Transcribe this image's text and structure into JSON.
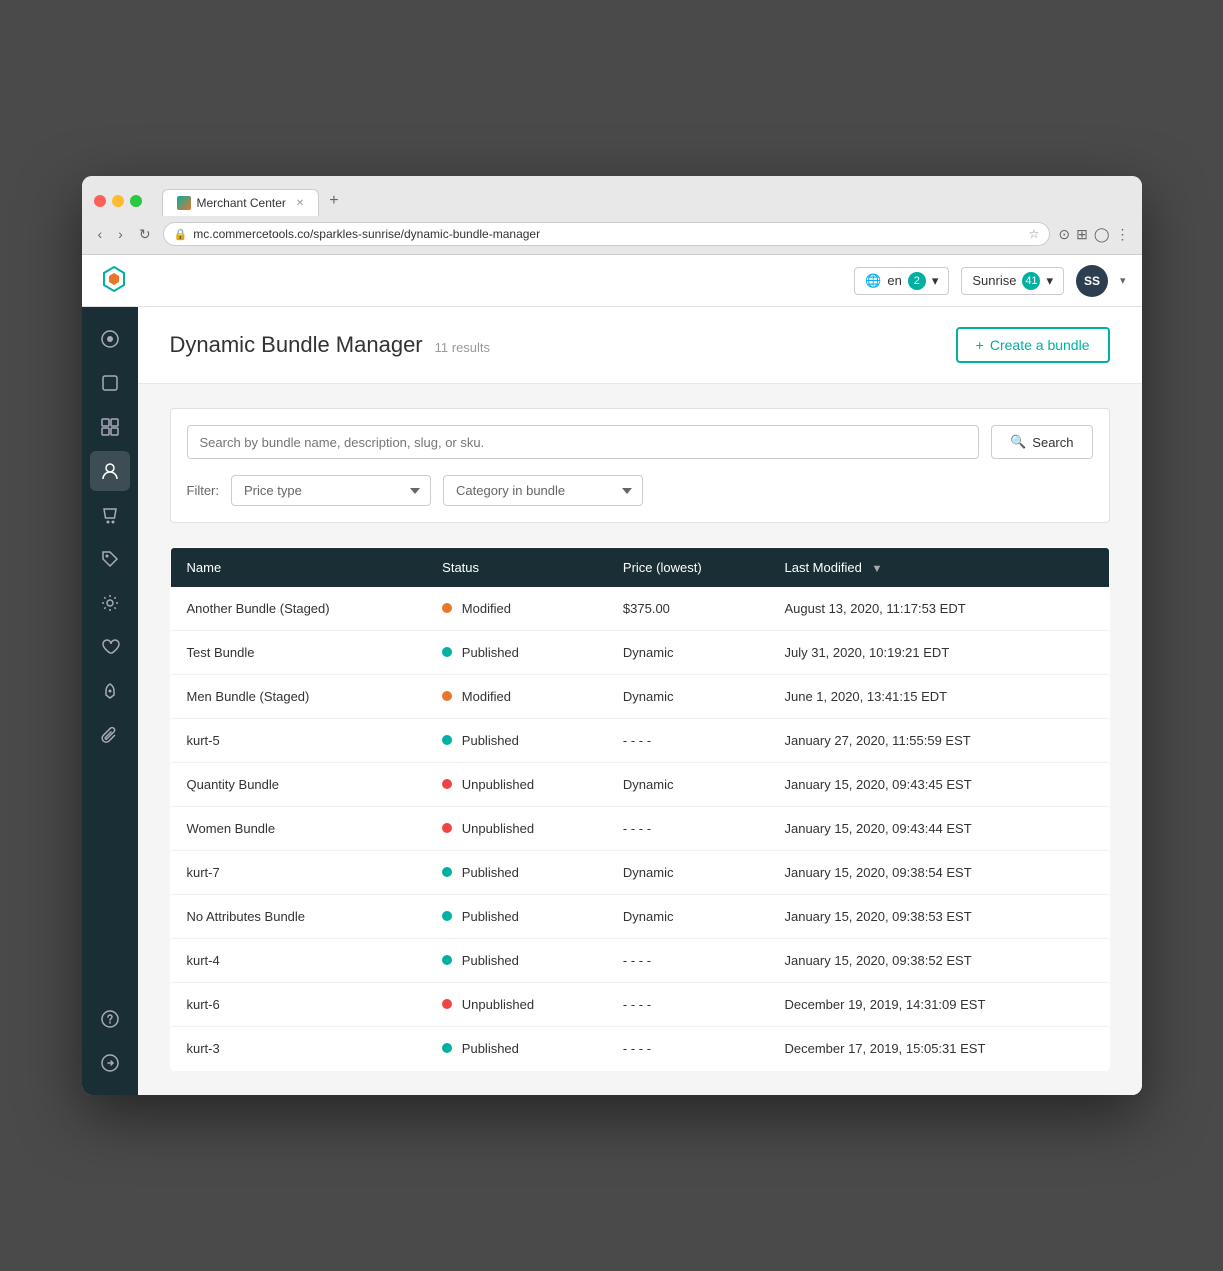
{
  "browser": {
    "url": "mc.commercetools.co/sparkles-sunrise/dynamic-bundle-manager",
    "tab_title": "Merchant Center"
  },
  "topbar": {
    "locale_label": "en",
    "locale_count": "2",
    "project_name": "Sunrise",
    "project_count": "41",
    "avatar_initials": "SS"
  },
  "page": {
    "title": "Dynamic Bundle Manager",
    "results_count": "11 results",
    "create_button": "Create a bundle",
    "search_placeholder": "Search by bundle name, description, slug, or sku.",
    "search_button": "Search",
    "filter_label": "Filter:",
    "filter_price_type": "Price type",
    "filter_category": "Category in bundle"
  },
  "table": {
    "columns": [
      "Name",
      "Status",
      "Price (lowest)",
      "Last Modified"
    ],
    "rows": [
      {
        "name": "Another Bundle (Staged)",
        "status": "Modified",
        "status_type": "modified",
        "price": "$375.00",
        "last_modified": "August 13, 2020, 11:17:53 EDT"
      },
      {
        "name": "Test Bundle",
        "status": "Published",
        "status_type": "published",
        "price": "Dynamic",
        "last_modified": "July 31, 2020, 10:19:21 EDT"
      },
      {
        "name": "Men Bundle (Staged)",
        "status": "Modified",
        "status_type": "modified",
        "price": "Dynamic",
        "last_modified": "June 1, 2020, 13:41:15 EDT"
      },
      {
        "name": "kurt-5",
        "status": "Published",
        "status_type": "published",
        "price": "- - - -",
        "last_modified": "January 27, 2020, 11:55:59 EST"
      },
      {
        "name": "Quantity Bundle",
        "status": "Unpublished",
        "status_type": "unpublished",
        "price": "Dynamic",
        "last_modified": "January 15, 2020, 09:43:45 EST"
      },
      {
        "name": "Women Bundle",
        "status": "Unpublished",
        "status_type": "unpublished",
        "price": "- - - -",
        "last_modified": "January 15, 2020, 09:43:44 EST"
      },
      {
        "name": "kurt-7",
        "status": "Published",
        "status_type": "published",
        "price": "Dynamic",
        "last_modified": "January 15, 2020, 09:38:54 EST"
      },
      {
        "name": "No Attributes Bundle",
        "status": "Published",
        "status_type": "published",
        "price": "Dynamic",
        "last_modified": "January 15, 2020, 09:38:53 EST"
      },
      {
        "name": "kurt-4",
        "status": "Published",
        "status_type": "published",
        "price": "- - - -",
        "last_modified": "January 15, 2020, 09:38:52 EST"
      },
      {
        "name": "kurt-6",
        "status": "Unpublished",
        "status_type": "unpublished",
        "price": "- - - -",
        "last_modified": "December 19, 2019, 14:31:09 EST"
      },
      {
        "name": "kurt-3",
        "status": "Published",
        "status_type": "published",
        "price": "- - - -",
        "last_modified": "December 17, 2019, 15:05:31 EST"
      }
    ]
  },
  "sidebar": {
    "items": [
      {
        "id": "dashboard",
        "icon": "⊙",
        "label": "Dashboard"
      },
      {
        "id": "products",
        "icon": "◻",
        "label": "Products"
      },
      {
        "id": "categories",
        "icon": "⊞",
        "label": "Categories"
      },
      {
        "id": "customers",
        "icon": "◯",
        "label": "Customers"
      },
      {
        "id": "orders",
        "icon": "◫",
        "label": "Orders"
      },
      {
        "id": "tags",
        "icon": "◈",
        "label": "Tags"
      },
      {
        "id": "settings",
        "icon": "⚙",
        "label": "Settings"
      },
      {
        "id": "wishlist",
        "icon": "♡",
        "label": "Wishlist"
      },
      {
        "id": "launch",
        "icon": "🚀",
        "label": "Launch"
      },
      {
        "id": "attach",
        "icon": "⊘",
        "label": "Attach"
      }
    ],
    "bottom_items": [
      {
        "id": "help",
        "icon": "?",
        "label": "Help"
      },
      {
        "id": "forward",
        "icon": "→",
        "label": "Navigate"
      }
    ]
  }
}
